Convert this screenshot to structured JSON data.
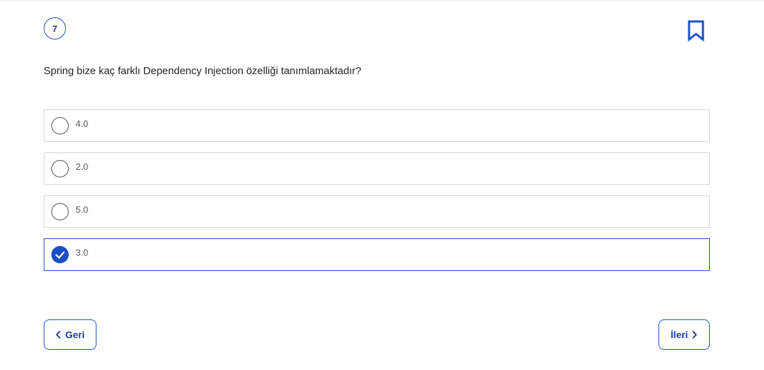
{
  "question": {
    "number": "7",
    "text": "Spring bize kaç farklı Dependency Injection özelliği tanımlamaktadır?",
    "bookmark_icon": "bookmark-icon"
  },
  "options": [
    {
      "label": "4.0",
      "selected": false
    },
    {
      "label": "2.0",
      "selected": false
    },
    {
      "label": "5.0",
      "selected": false
    },
    {
      "label": "3.0",
      "selected": true
    }
  ],
  "navigation": {
    "back_label": "Geri",
    "back_icon": "chevron-left-icon",
    "next_label": "İleri",
    "next_icon": "chevron-right-icon"
  },
  "colors": {
    "accent": "#1a4fc4",
    "border": "#d6d6d6",
    "text": "#222222",
    "muted": "#555555"
  }
}
